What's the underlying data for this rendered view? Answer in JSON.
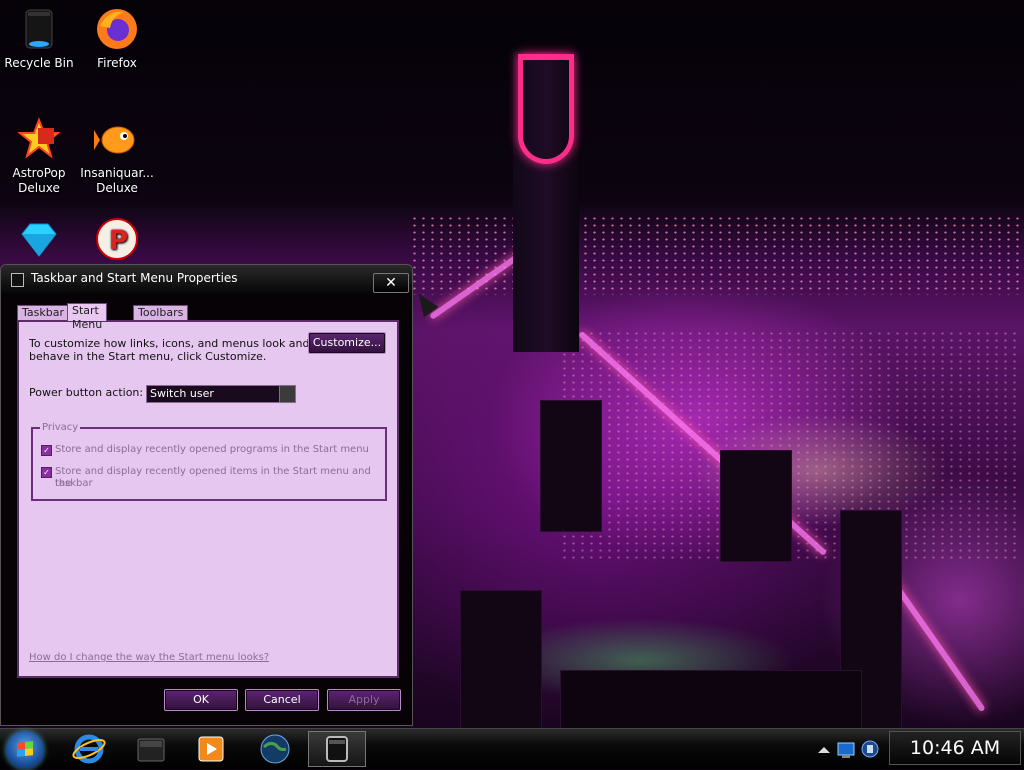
{
  "desktop": {
    "icons": [
      {
        "label": "Recycle Bin",
        "icon": "recycle-bin-icon"
      },
      {
        "label": "Firefox",
        "icon": "firefox-icon"
      },
      {
        "label_line1": "AstroPop",
        "label_line2": "Deluxe",
        "icon": "astropop-icon"
      },
      {
        "label_line1": "Insaniquar...",
        "label_line2": "Deluxe",
        "icon": "insaniquarium-icon"
      },
      {
        "label": "",
        "icon": "bejeweled-icon"
      },
      {
        "label": "",
        "icon": "peggle-icon"
      }
    ]
  },
  "dialog": {
    "title": "Taskbar and Start Menu Properties",
    "close_label": "✕",
    "tabs": [
      "Taskbar",
      "Start Menu",
      "Toolbars"
    ],
    "active_tab": "Start Menu",
    "intro_line1": "To customize how links, icons, and menus look and",
    "intro_line2": "behave in the Start menu, click Customize.",
    "customize_button": "Customize...",
    "power_label": "Power button action:",
    "power_value": "Switch user",
    "privacy": {
      "legend": "Privacy",
      "option1": "Store and display recently opened programs in the Start menu",
      "option2_line1": "Store and display recently opened items in the Start menu and the",
      "option2_line2": "taskbar",
      "option1_checked": true,
      "option2_checked": true
    },
    "help_link": "How do I change the way the Start menu looks?",
    "ok_label": "OK",
    "cancel_label": "Cancel",
    "apply_label": "Apply"
  },
  "taskbar": {
    "start_icon": "windows-start-icon",
    "pinned": [
      "internet-explorer-icon",
      "library-icon",
      "media-player-icon",
      "globe-icon",
      "window-icon"
    ],
    "clock": "10:46 AM"
  },
  "colors": {
    "panel_bg": "#e6c7ef",
    "button_bg": "#4a1a5a",
    "accent": "#ff2d8a"
  }
}
